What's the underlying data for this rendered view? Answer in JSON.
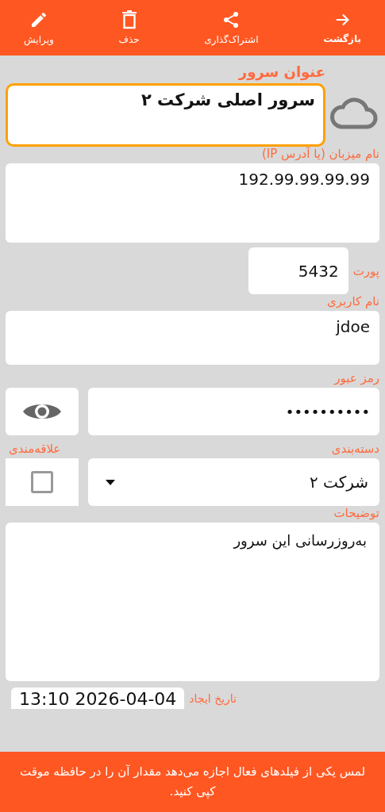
{
  "toolbar": [
    {
      "kind": "back",
      "label": "بازگشت"
    },
    {
      "kind": "share",
      "label": "اشتراک‌گذاری"
    },
    {
      "kind": "delete",
      "label": "حذف"
    },
    {
      "kind": "edit",
      "label": "ویرایش"
    }
  ],
  "title_field": {
    "label": "عنوان سرور",
    "value": "سرور اصلی شرکت ۲",
    "focused": true
  },
  "host": {
    "label": "نام میزبان (یا آدرس IP)",
    "value": "192.99.99.99.99"
  },
  "port": {
    "label": "پورت",
    "value": "5432"
  },
  "username": {
    "label": "نام کاربری",
    "value": "jdoe"
  },
  "password": {
    "label": "رمز عبور",
    "value": "••••••••••"
  },
  "category": {
    "label": "دسته‌بندی",
    "value": "شرکت ۲"
  },
  "favorite": {
    "label": "علاقه‌مندی",
    "checked": false
  },
  "description": {
    "label": "توضیحات",
    "value": "به‌روزرسانی این سرور"
  },
  "created": {
    "label": "تاریخ ایجاد",
    "value": "13:10 2026-04-04"
  },
  "message": "لمس یکی از فیلدهای فعال اجازه می‌دهد مقدار آن را در حافظه موقت کپی کنید."
}
